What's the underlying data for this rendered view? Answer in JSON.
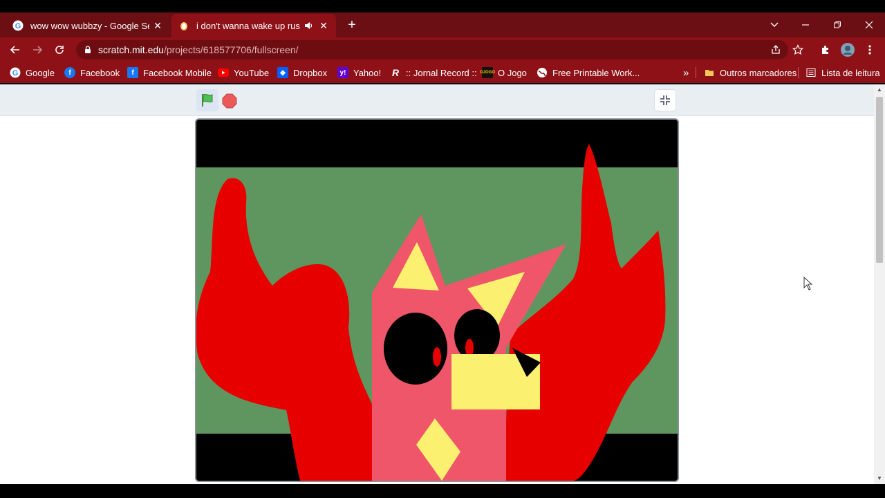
{
  "tabs": [
    {
      "title": "wow wow wubbzy - Google Search",
      "icon": "google-icon"
    },
    {
      "title": "i don't wanna wake up rusty",
      "icon": "scratch-cat-icon",
      "audio": "speaker-icon"
    }
  ],
  "address": {
    "host": "scratch.mit.edu",
    "path": "/projects/618577706/fullscreen/"
  },
  "bookmarks": [
    {
      "label": "Google",
      "icon": "google-icon"
    },
    {
      "label": "Facebook",
      "icon": "facebook-icon"
    },
    {
      "label": "Facebook Mobile",
      "icon": "facebook-icon"
    },
    {
      "label": "YouTube",
      "icon": "youtube-icon"
    },
    {
      "label": "Dropbox",
      "icon": "dropbox-icon"
    },
    {
      "label": "Yahoo!",
      "icon": "yahoo-icon"
    },
    {
      "label": ":: Jornal Record ::",
      "icon": "record-icon"
    },
    {
      "label": "O Jogo",
      "icon": "ojogo-icon"
    },
    {
      "label": "Free Printable Work...",
      "icon": "globe-icon"
    }
  ],
  "bookmarks_overflow": "»",
  "other_bookmarks": "Outros marcadores",
  "reading_list": "Lista de leitura",
  "colors": {
    "chrome_dark": "#6b0f14",
    "chrome": "#8e1118",
    "stage_bg": "#5f9660",
    "creature_body": "#f0566a",
    "wings": "#e60000",
    "accent_yellow": "#fbf06f"
  }
}
